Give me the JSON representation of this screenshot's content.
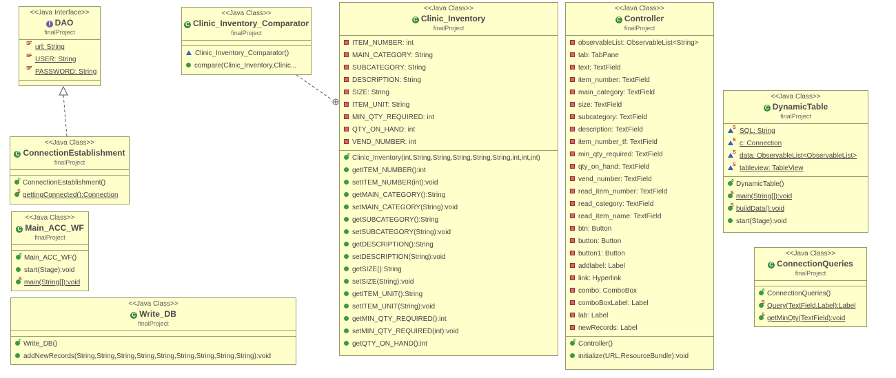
{
  "classes": {
    "dao": {
      "stereotype": "<<Java Interface>>",
      "name": "DAO",
      "package": "finalProject",
      "fields": [
        "url: String",
        "USER: String",
        "PASSWORD: String"
      ]
    },
    "connection_establishment": {
      "stereotype": "<<Java Class>>",
      "name": "ConnectionEstablishment",
      "package": "finalProject",
      "methods": [
        "ConnectionEstablishment()",
        "gettingConnected():Connection"
      ]
    },
    "main_acc_wf": {
      "stereotype": "<<Java Class>>",
      "name": "Main_ACC_WF",
      "package": "finalProject",
      "methods": [
        "Main_ACC_WF()",
        "start(Stage):void",
        "main(String[]):void"
      ]
    },
    "write_db": {
      "stereotype": "<<Java Class>>",
      "name": "Write_DB",
      "package": "finalProject",
      "methods": [
        "Write_DB()",
        "addNewRecords(String,String,String,String,String,String,String,String,String):void"
      ]
    },
    "comparator": {
      "stereotype": "<<Java Class>>",
      "name": "Clinic_Inventory_Comparator",
      "package": "finalProject",
      "methods": [
        "Clinic_Inventory_Comparator()",
        "compare(Clinic_Inventory,Clinic..."
      ]
    },
    "clinic_inventory": {
      "stereotype": "<<Java Class>>",
      "name": "Clinic_Inventory",
      "package": "finalProject",
      "fields": [
        "ITEM_NUMBER: int",
        "MAIN_CATEGORY: String",
        "SUBCATEGORY: String",
        "DESCRIPTION: String",
        "SIZE: String",
        "ITEM_UNIT: String",
        "MIN_QTY_REQUIRED: int",
        "QTY_ON_HAND: int",
        "VEND_NUMBER: int"
      ],
      "methods": [
        "Clinic_Inventory(int,String,String,String,String,String,int,int,int)",
        "getITEM_NUMBER():int",
        "setITEM_NUMBER(int):void",
        "getMAIN_CATEGORY():String",
        "setMAIN_CATEGORY(String):void",
        "getSUBCATEGORY():String",
        "setSUBCATEGORY(String):void",
        "getDESCRIPTION():String",
        "setDESCRIPTION(String):void",
        "getSIZE():String",
        "setSIZE(String):void",
        "getITEM_UNIT():String",
        "setITEM_UNIT(String):void",
        "getMIN_QTY_REQUIRED():int",
        "setMIN_QTY_REQUIRED(int):void",
        "getQTY_ON_HAND():int"
      ]
    },
    "controller": {
      "stereotype": "<<Java Class>>",
      "name": "Controller",
      "package": "finalProject",
      "fields": [
        "observableList: ObservableList<String>",
        "tab: TabPane",
        "text: TextField",
        "item_number: TextField",
        "main_category: TextField",
        "size: TextField",
        "subcategory: TextField",
        "description: TextField",
        "item_number_tf: TextField",
        "min_qty_required: TextField",
        "qty_on_hand: TextField",
        "vend_number: TextField",
        "read_item_number: TextField",
        "read_category: TextField",
        "read_item_name: TextField",
        "btn: Button",
        "button: Button",
        "button1: Button",
        "addlabel: Label",
        "link: Hyperlink",
        "combo: ComboBox",
        "comboBoxLabel: Label",
        "lab: Label",
        "newRecords: Label"
      ],
      "methods": [
        "Controller()",
        "initialize(URL,ResourceBundle):void"
      ]
    },
    "dynamic_table": {
      "stereotype": "<<Java Class>>",
      "name": "DynamicTable",
      "package": "finalProject",
      "fields": [
        "SQL: String",
        "c: Connection",
        "data: ObservableList<ObservableList>",
        "tableview: TableView"
      ],
      "methods": [
        "DynamicTable()",
        "main(String[]):void",
        "buildData():void",
        "start(Stage):void"
      ]
    },
    "connection_queries": {
      "stereotype": "<<Java Class>>",
      "name": "ConnectionQueries",
      "package": "finalProject",
      "methods": [
        "ConnectionQueries()",
        "Query(TextField,Label):Label",
        "getMinQty(TextField):void"
      ]
    }
  }
}
